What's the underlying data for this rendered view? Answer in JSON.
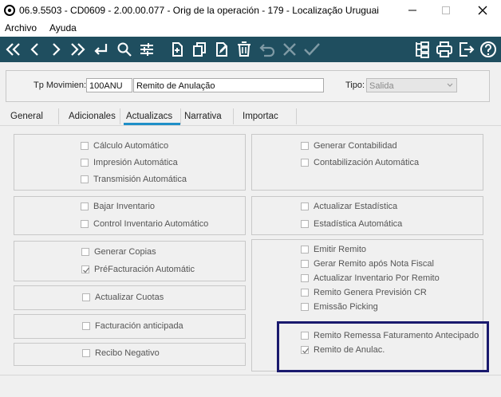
{
  "window": {
    "title": "06.9.5503 - CD0609 - 2.00.00.077 - Orig de la operación - 179 - Localização Uruguai",
    "minimize_icon": "minimize-icon",
    "maximize_icon": "maximize-icon",
    "close_icon": "close-icon"
  },
  "menu": {
    "items": [
      {
        "label": "Archivo"
      },
      {
        "label": "Ayuda"
      }
    ]
  },
  "toolbar": {
    "left_icons": [
      "first-icon",
      "previous-icon",
      "next-icon",
      "last-icon",
      "goto-icon",
      "search-icon",
      "filter-icon",
      "new-icon",
      "copy-icon",
      "edit-icon",
      "delete-icon",
      "undo-icon",
      "cancel-icon",
      "confirm-icon"
    ],
    "right_icons": [
      "tree-icon",
      "print-icon",
      "exit-icon",
      "help-icon"
    ],
    "color": "#1f4e5f"
  },
  "header": {
    "tp_label": "Tp Movimien:",
    "tp_code": "100ANU",
    "tp_desc": "Remito de Anulação",
    "tipo_label": "Tipo:",
    "tipo_value": "Salida"
  },
  "tabs": [
    {
      "label": "General"
    },
    {
      "label": "Adicionales"
    },
    {
      "label": "Actualizacs",
      "active": true
    },
    {
      "label": "Narrativa"
    },
    {
      "label": "Importac"
    }
  ],
  "left": {
    "g1": [
      {
        "label": "Cálculo Automático",
        "checked": false
      },
      {
        "label": "Impresión Automática",
        "checked": false
      },
      {
        "label": "Transmisión Automática",
        "checked": false
      }
    ],
    "g2": [
      {
        "label": "Bajar Inventario",
        "checked": false
      },
      {
        "label": "Control Inventario Automático",
        "checked": false
      }
    ],
    "g3": [
      {
        "label": "Generar Copias",
        "checked": false
      },
      {
        "label": "PréFacturación Automátic",
        "checked": true
      }
    ],
    "g4": [
      {
        "label": "Actualizar Cuotas",
        "checked": false
      }
    ],
    "g5": [
      {
        "label": "Facturación anticipada",
        "checked": false
      }
    ],
    "g6": [
      {
        "label": "Recibo Negativo",
        "checked": false
      }
    ]
  },
  "right": {
    "g1": [
      {
        "label": "Generar Contabilidad",
        "checked": false
      },
      {
        "label": "Contabilización Automática",
        "checked": false
      }
    ],
    "g2": [
      {
        "label": "Actualizar Estadística",
        "checked": false
      },
      {
        "label": "Estadística Automática",
        "checked": false
      }
    ],
    "g3": [
      {
        "label": "Emitir Remito",
        "checked": false
      },
      {
        "label": "Gerar Remito após Nota Fiscal",
        "checked": false
      },
      {
        "label": "Actualizar Inventario Por Remito",
        "checked": false
      },
      {
        "label": "Remito Genera Previsión CR",
        "checked": false
      },
      {
        "label": "Emissão Picking",
        "checked": false
      },
      {
        "label": "Remito Remessa Faturamento Antecipado",
        "checked": false
      },
      {
        "label": "Remito de Anulac.",
        "checked": true
      }
    ]
  },
  "colors": {
    "toolbar": "#1f4e5f",
    "tab_active": "#1f8fc8",
    "highlight": "#1a1a6e"
  }
}
